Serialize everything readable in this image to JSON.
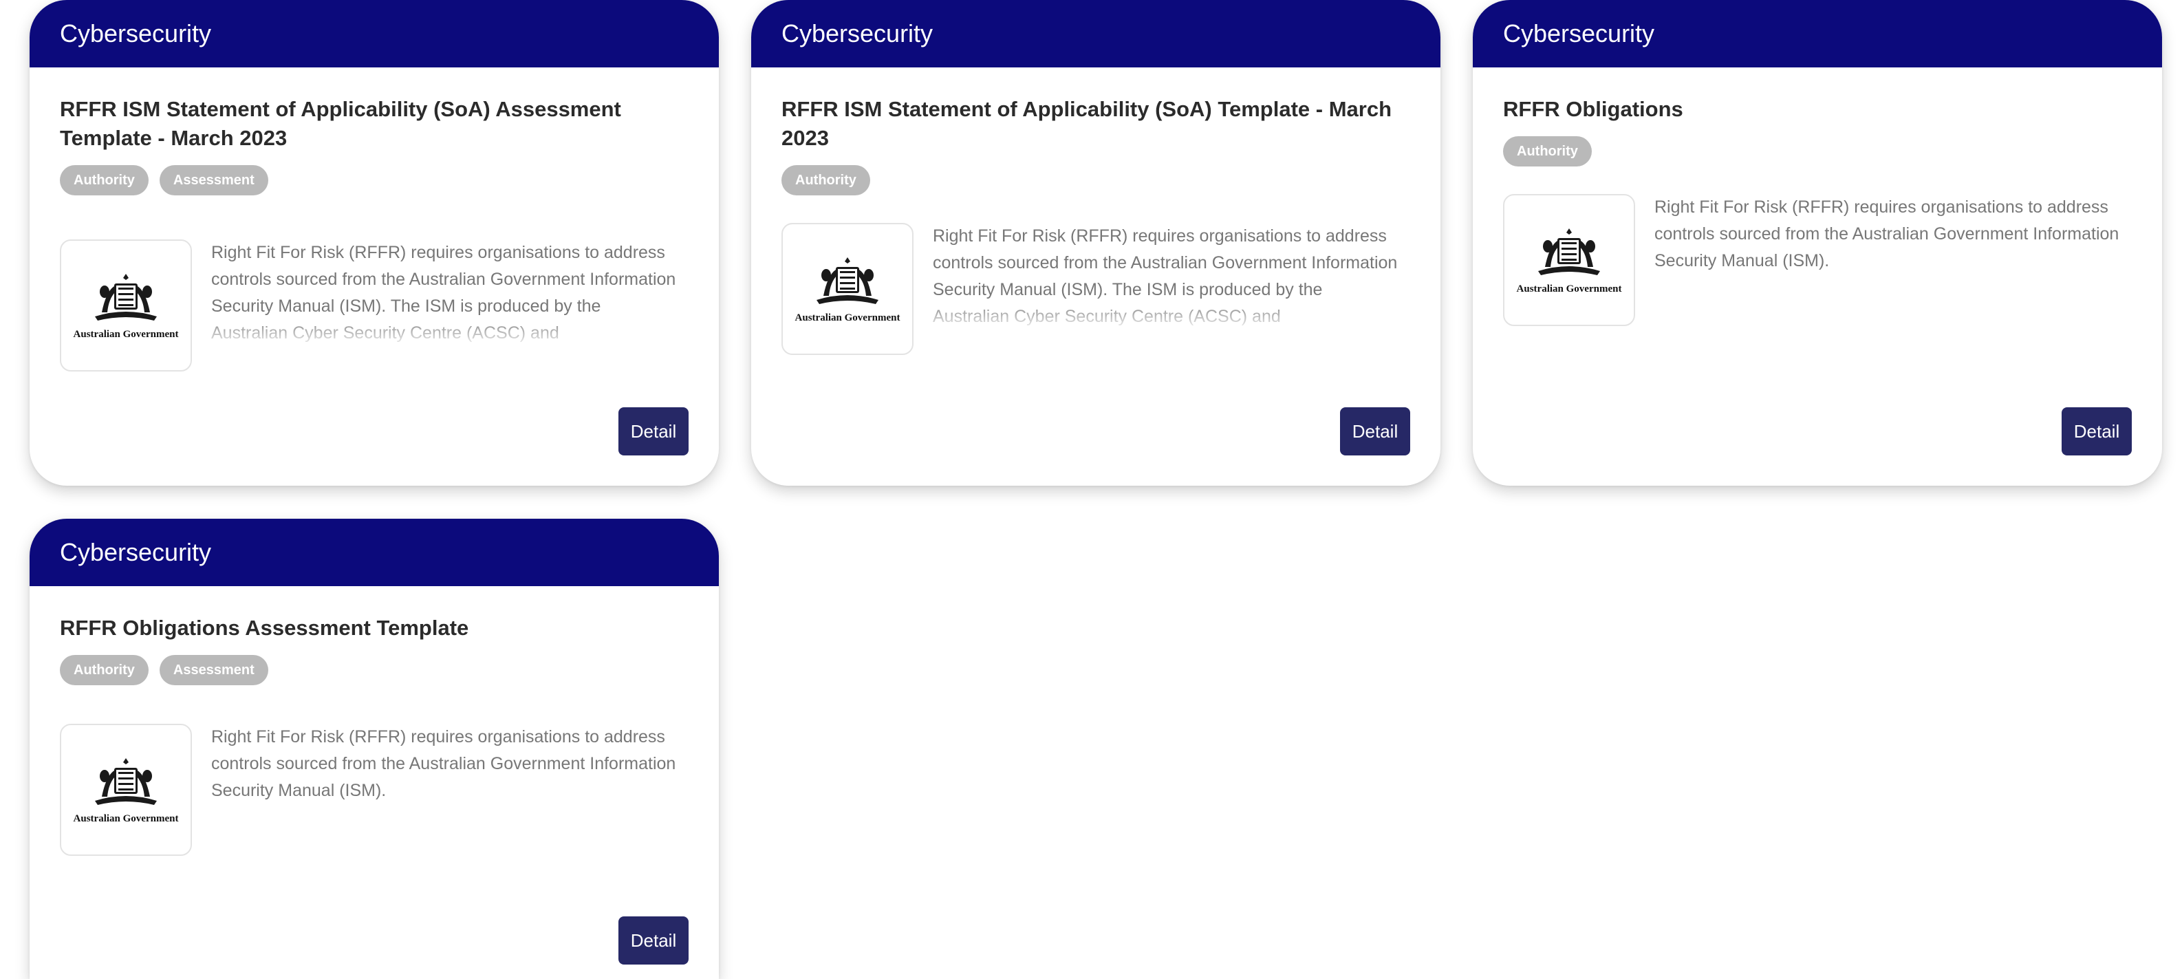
{
  "cards": [
    {
      "category": "Cybersecurity",
      "title": "RFFR ISM Statement of Applicability (SoA) Assessment Template - March 2023",
      "tags": [
        "Authority",
        "Assessment"
      ],
      "logo_caption": "Australian Government",
      "description": "Right Fit For Risk (RFFR) requires organisations to address controls sourced from the Australian Government Information Security Manual (ISM). The ISM is produced by the Australian Cyber Security Centre (ACSC) and",
      "button": "Detail"
    },
    {
      "category": "Cybersecurity",
      "title": "RFFR ISM Statement of Applicability (SoA) Template - March 2023",
      "tags": [
        "Authority"
      ],
      "logo_caption": "Australian Government",
      "description": "Right Fit For Risk (RFFR) requires organisations to address controls sourced from the Australian Government Information Security Manual (ISM). The ISM is produced by the Australian Cyber Security Centre (ACSC) and",
      "button": "Detail"
    },
    {
      "category": "Cybersecurity",
      "title": "RFFR Obligations",
      "tags": [
        "Authority"
      ],
      "logo_caption": "Australian Government",
      "description": "Right Fit For Risk (RFFR) requires organisations to address controls sourced from the Australian Government Information Security Manual (ISM).",
      "button": "Detail"
    },
    {
      "category": "Cybersecurity",
      "title": "RFFR Obligations Assessment Template",
      "tags": [
        "Authority",
        "Assessment"
      ],
      "logo_caption": "Australian Government",
      "description": "Right Fit For Risk (RFFR) requires organisations to address controls sourced from the Australian Government Information Security Manual (ISM).",
      "button": "Detail"
    }
  ],
  "colors": {
    "header": "#0c0a7c",
    "button": "#262866",
    "tag": "#b9b9b9",
    "description": "#777777"
  },
  "icons": {
    "logo": "australian-government-crest-icon"
  }
}
